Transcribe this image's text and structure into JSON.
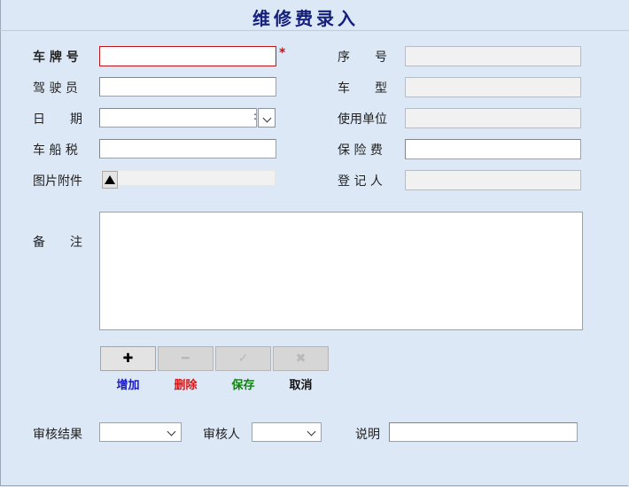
{
  "title": "维修费录入",
  "form": {
    "plate": {
      "label": "车 牌 号",
      "value": "",
      "required_mark": "*"
    },
    "driver": {
      "label": "驾 驶 员",
      "value": ""
    },
    "date": {
      "label": "日　　期",
      "value": "",
      "spin_text": ":"
    },
    "vessel_tax": {
      "label": "车 船 税",
      "value": ""
    },
    "attachment": {
      "label": "图片附件"
    },
    "serial": {
      "label": "序　　号",
      "value": ""
    },
    "model": {
      "label": "车　　型",
      "value": ""
    },
    "unit": {
      "label": "使用单位",
      "value": ""
    },
    "insurance": {
      "label": "保 险 费",
      "value": ""
    },
    "registrar": {
      "label": "登 记 人",
      "value": ""
    },
    "remarks": {
      "label": "备　　注",
      "value": ""
    }
  },
  "toolbar": {
    "add": {
      "icon": "plus-icon",
      "glyph": "✚",
      "label": "增加",
      "color": "#1a1acc"
    },
    "delete": {
      "icon": "minus-icon",
      "glyph": "━",
      "label": "删除",
      "color": "#d01818"
    },
    "save": {
      "icon": "check-icon",
      "glyph": "✓",
      "label": "保存",
      "color": "#108010"
    },
    "cancel": {
      "icon": "x-icon",
      "glyph": "✖",
      "label": "取消",
      "color": "#111111"
    }
  },
  "review": {
    "result_label": "审核结果",
    "result_value": "",
    "reviewer_label": "审核人",
    "reviewer_value": "",
    "note_label": "说明",
    "note_value": ""
  },
  "colors": {
    "title": "#14207a",
    "required": "#c0161a",
    "background": "#dde8f7"
  }
}
